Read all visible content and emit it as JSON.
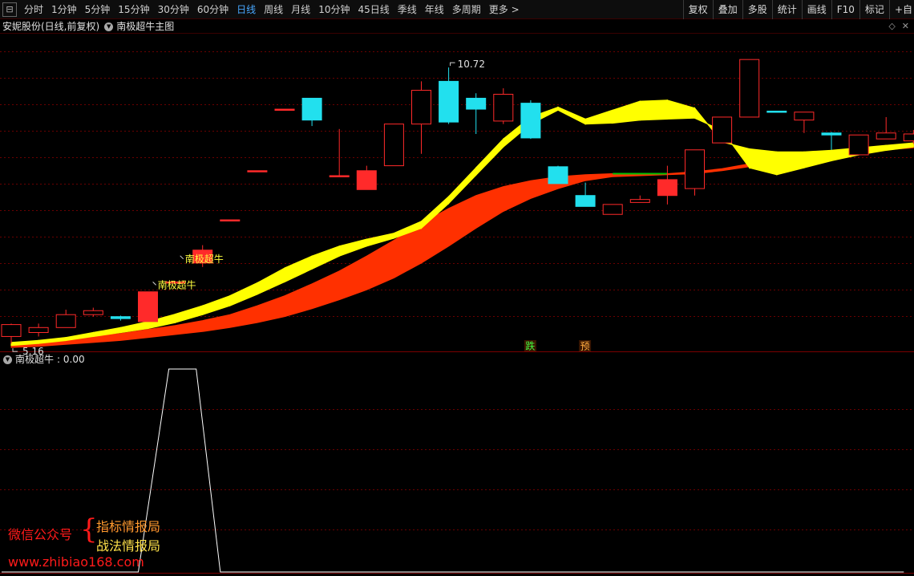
{
  "toolbar": {
    "menu_icon": "menu-square-icon",
    "periods": [
      "分时",
      "1分钟",
      "5分钟",
      "15分钟",
      "30分钟",
      "60分钟",
      "日线",
      "周线",
      "月线",
      "10分钟",
      "45日线",
      "季线",
      "年线",
      "多周期",
      "更多 >"
    ],
    "active_period": "日线",
    "tools": [
      "复权",
      "叠加",
      "多股",
      "统计",
      "画线",
      "F10",
      "标记",
      "+自"
    ]
  },
  "main_chart": {
    "stock_title": "安妮股份(日线,前复权)",
    "indicator": "南极超牛主图",
    "high_label": "10.72",
    "low_label": "5.16",
    "signal_labels": [
      "南极超牛",
      "南极超牛"
    ],
    "marker_labels": [
      "跌",
      "预"
    ],
    "colors": {
      "up": "#ff2a2a",
      "down": "#22e0ee",
      "fast_band": "#ffff00",
      "slow_band": "#ff3000",
      "bear_band": "#0a14ff",
      "cross_line": "#00c000"
    },
    "candles": [
      {
        "o": 5.3,
        "h": 5.56,
        "l": 5.16,
        "c": 5.54
      },
      {
        "o": 5.38,
        "h": 5.56,
        "l": 5.3,
        "c": 5.48
      },
      {
        "o": 5.48,
        "h": 5.84,
        "l": 5.48,
        "c": 5.74
      },
      {
        "o": 5.74,
        "h": 5.88,
        "l": 5.7,
        "c": 5.82
      },
      {
        "o": 5.7,
        "h": 5.72,
        "l": 5.62,
        "c": 5.66
      },
      {
        "o": 5.6,
        "h": 6.2,
        "l": 5.6,
        "c": 6.2
      },
      {
        "o": 6.4,
        "h": 6.4,
        "l": 6.4,
        "c": 6.4
      },
      {
        "o": 6.78,
        "h": 7.14,
        "l": 6.7,
        "c": 7.04
      },
      {
        "o": 7.65,
        "h": 7.65,
        "l": 7.65,
        "c": 7.65
      },
      {
        "o": 8.64,
        "h": 8.64,
        "l": 8.64,
        "c": 8.64
      },
      {
        "o": 9.88,
        "h": 9.88,
        "l": 9.88,
        "c": 9.88
      },
      {
        "o": 10.1,
        "h": 10.1,
        "l": 9.54,
        "c": 9.66
      },
      {
        "o": 8.54,
        "h": 9.48,
        "l": 8.52,
        "c": 8.54
      },
      {
        "o": 8.26,
        "h": 8.74,
        "l": 8.26,
        "c": 8.64
      },
      {
        "o": 8.74,
        "h": 9.58,
        "l": 8.74,
        "c": 9.58
      },
      {
        "o": 9.58,
        "h": 10.44,
        "l": 8.98,
        "c": 10.26
      },
      {
        "o": 10.44,
        "h": 10.72,
        "l": 9.58,
        "c": 9.62
      },
      {
        "o": 10.1,
        "h": 10.2,
        "l": 9.38,
        "c": 9.88
      },
      {
        "o": 9.64,
        "h": 10.3,
        "l": 9.58,
        "c": 10.18
      },
      {
        "o": 10.0,
        "h": 10.06,
        "l": 9.28,
        "c": 9.3
      },
      {
        "o": 8.72,
        "h": 8.74,
        "l": 8.38,
        "c": 8.38
      },
      {
        "o": 8.14,
        "h": 8.4,
        "l": 7.92,
        "c": 7.92
      },
      {
        "o": 7.76,
        "h": 7.96,
        "l": 7.76,
        "c": 7.96
      },
      {
        "o": 8.0,
        "h": 8.14,
        "l": 8.0,
        "c": 8.06
      },
      {
        "o": 8.14,
        "h": 8.74,
        "l": 7.96,
        "c": 8.46
      },
      {
        "o": 8.28,
        "h": 9.04,
        "l": 8.14,
        "c": 9.06
      },
      {
        "o": 9.2,
        "h": 9.7,
        "l": 9.2,
        "c": 9.72
      },
      {
        "o": 9.72,
        "h": 10.86,
        "l": 9.72,
        "c": 10.88
      },
      {
        "o": 9.84,
        "h": 9.84,
        "l": 9.82,
        "c": 9.82
      },
      {
        "o": 9.66,
        "h": 9.8,
        "l": 9.4,
        "c": 9.82
      },
      {
        "o": 9.4,
        "h": 9.42,
        "l": 9.06,
        "c": 9.36
      },
      {
        "o": 8.96,
        "h": 9.36,
        "l": 8.96,
        "c": 9.36
      },
      {
        "o": 9.28,
        "h": 9.72,
        "l": 9.28,
        "c": 9.4
      },
      {
        "o": 9.24,
        "h": 9.46,
        "l": 9.18,
        "c": 9.38
      }
    ],
    "fast_band": {
      "upper": [
        5.18,
        5.22,
        5.28,
        5.38,
        5.48,
        5.6,
        5.75,
        5.92,
        6.12,
        6.38,
        6.68,
        6.92,
        7.12,
        7.26,
        7.38,
        7.62,
        8.12,
        8.7,
        9.28,
        9.72,
        9.92,
        9.68,
        9.86,
        10.04,
        10.06,
        9.9,
        9.22,
        9.08,
        9.02,
        9.02,
        9.05,
        9.1,
        9.15,
        9.2
      ],
      "lower": [
        5.12,
        5.16,
        5.22,
        5.3,
        5.38,
        5.46,
        5.58,
        5.74,
        5.92,
        6.15,
        6.4,
        6.66,
        6.92,
        7.12,
        7.28,
        7.48,
        7.98,
        8.55,
        9.12,
        9.58,
        9.86,
        9.58,
        9.6,
        9.66,
        9.68,
        9.7,
        9.45,
        8.7,
        8.56,
        8.7,
        8.84,
        8.96,
        9.05,
        9.12
      ]
    },
    "slow_band": {
      "upper": [
        5.14,
        5.18,
        5.24,
        5.3,
        5.36,
        5.44,
        5.52,
        5.62,
        5.74,
        5.92,
        6.12,
        6.36,
        6.62,
        6.92,
        7.24,
        7.58,
        7.88,
        8.14,
        8.32,
        8.44,
        8.52,
        8.56,
        8.58,
        8.58,
        8.58,
        8.62,
        8.68,
        8.78,
        8.86,
        8.94,
        9.0,
        9.06,
        9.1,
        9.16
      ],
      "lower": [
        5.08,
        5.1,
        5.14,
        5.18,
        5.22,
        5.28,
        5.34,
        5.4,
        5.48,
        5.58,
        5.7,
        5.86,
        6.04,
        6.24,
        6.48,
        6.78,
        7.12,
        7.48,
        7.82,
        8.08,
        8.28,
        8.44,
        8.52,
        8.54,
        8.56,
        8.58,
        8.64,
        8.72,
        8.8,
        8.88,
        8.96,
        9.02,
        9.06,
        9.1
      ]
    },
    "ylim": [
      5.0,
      11.4
    ]
  },
  "sub_chart": {
    "name": "南极超牛",
    "value": "0.00",
    "values": [
      0,
      0,
      0,
      0,
      0,
      0,
      1,
      1,
      0,
      0,
      0,
      0,
      0,
      0,
      0,
      0,
      0,
      0,
      0,
      0,
      0,
      0,
      0,
      0,
      0,
      0,
      0,
      0,
      0,
      0,
      0,
      0,
      0,
      0
    ],
    "line_color": "#ffffff"
  },
  "watermark": {
    "left_text": "微信公众号",
    "brace": "{",
    "right_line1": "指标情报局",
    "right_line2": "战法情报局",
    "url": "www.zhibiao168.com"
  }
}
